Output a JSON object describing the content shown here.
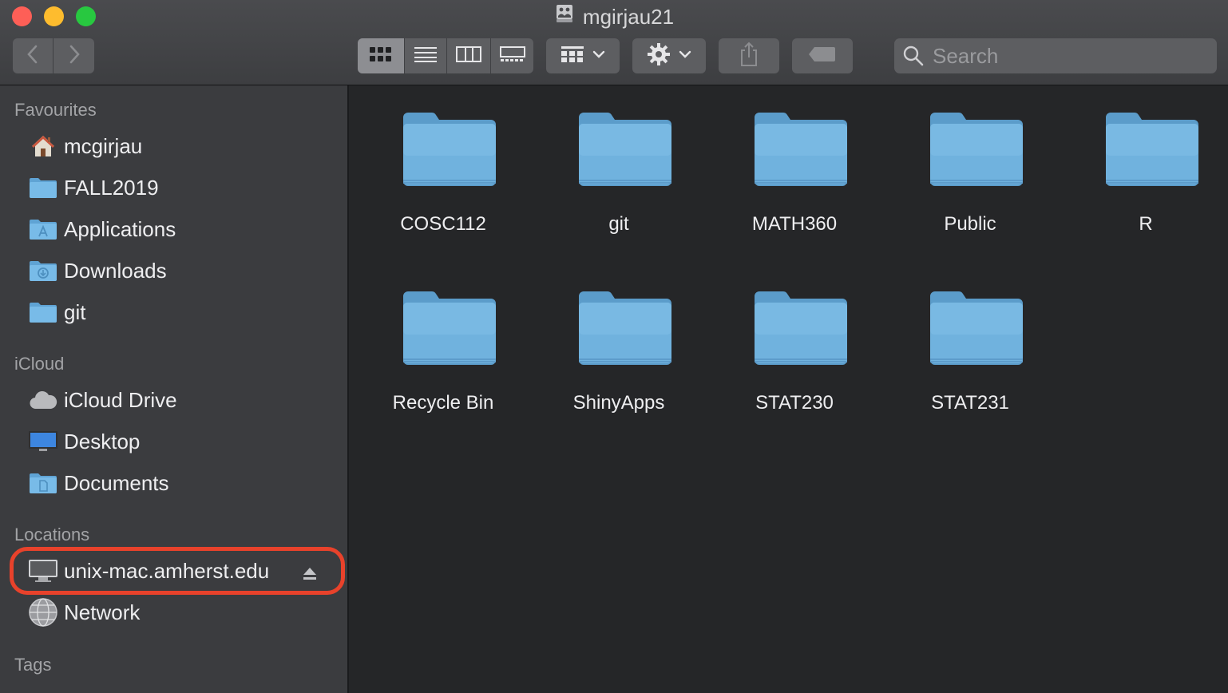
{
  "window": {
    "title": "mgirjau21"
  },
  "toolbar": {
    "view_modes": [
      "icon-view",
      "list-view",
      "column-view",
      "gallery-view"
    ],
    "selected_view": "icon-view",
    "search_placeholder": "Search"
  },
  "sidebar": {
    "favourites_title": "Favourites",
    "favourites": [
      {
        "label": "mcgirjau",
        "icon": "home-icon"
      },
      {
        "label": "FALL2019",
        "icon": "folder-icon"
      },
      {
        "label": "Applications",
        "icon": "applications-folder-icon"
      },
      {
        "label": "Downloads",
        "icon": "downloads-folder-icon"
      },
      {
        "label": "git",
        "icon": "folder-icon"
      }
    ],
    "icloud_title": "iCloud",
    "icloud": [
      {
        "label": "iCloud Drive",
        "icon": "cloud-icon"
      },
      {
        "label": "Desktop",
        "icon": "desktop-icon"
      },
      {
        "label": "Documents",
        "icon": "documents-folder-icon"
      }
    ],
    "locations_title": "Locations",
    "locations": [
      {
        "label": "unix-mac.amherst.edu",
        "icon": "server-monitor-icon",
        "highlighted": true
      },
      {
        "label": "Network",
        "icon": "network-globe-icon"
      }
    ],
    "tags_title": "Tags"
  },
  "content": {
    "folders": [
      "COSC112",
      "git",
      "MATH360",
      "Public",
      "R",
      "Recycle Bin",
      "ShinyApps",
      "STAT230",
      "STAT231"
    ]
  },
  "colors": {
    "folder_blue": "#6fb1dd",
    "highlight_ring": "#e8422b",
    "sidebar_bg": "#3b3c3f",
    "content_bg": "#252628"
  }
}
